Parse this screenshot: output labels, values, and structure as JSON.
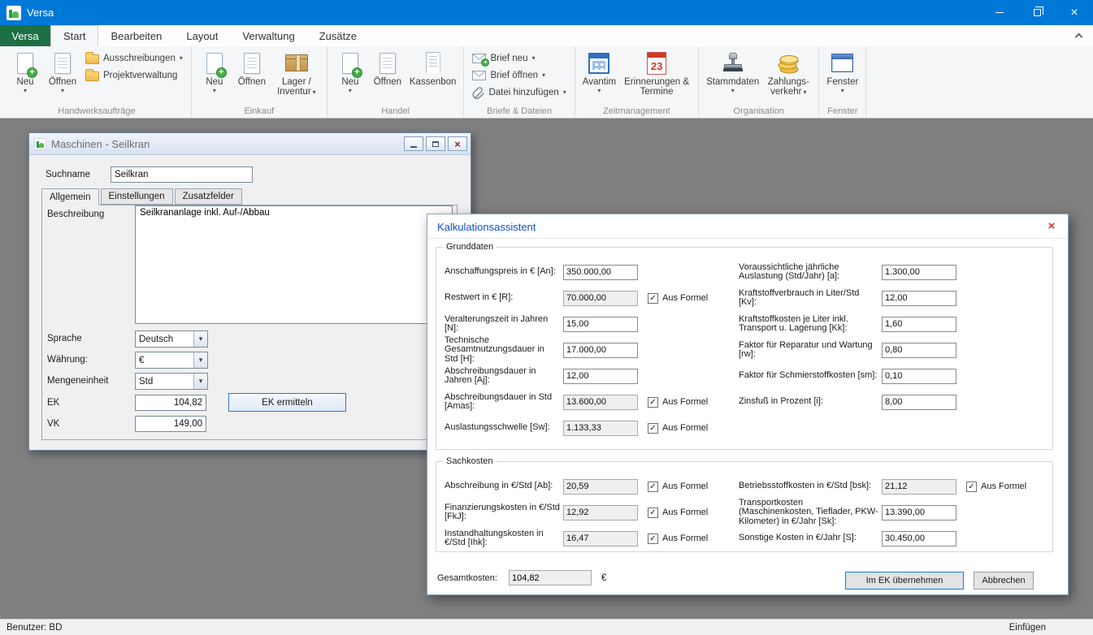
{
  "colors": {
    "titlebar_blue": "#0078d7",
    "versa_green": "#1d7044",
    "workspace_gray": "#7f7f7f",
    "dialog_title_blue": "#0a4fd6",
    "close_red": "#c43b2e",
    "default_button_border": "#2a7ad4"
  },
  "icons": {
    "dropdown_arrow": "▾",
    "close_x": "×",
    "check": "✓",
    "plus": "+"
  },
  "titlebar": {
    "app_title": "Versa"
  },
  "menubar": {
    "file_tab": "Versa",
    "tabs": [
      "Start",
      "Bearbeiten",
      "Layout",
      "Verwaltung",
      "Zusätze"
    ]
  },
  "ribbon": {
    "handwerk": {
      "label": "Handwerksaufträge",
      "neu": "Neu",
      "oeffnen": "Öffnen",
      "ausschreibungen": "Ausschreibungen",
      "projektverwaltung": "Projektverwaltung"
    },
    "einkauf": {
      "label": "Einkauf",
      "neu": "Neu",
      "oeffnen": "Öffnen",
      "lager": "Lager / Inventur"
    },
    "handel": {
      "label": "Handel",
      "neu": "Neu",
      "oeffnen": "Öffnen",
      "kassenbon": "Kassenbon"
    },
    "briefe": {
      "label": "Briefe & Dateien",
      "brief_neu": "Brief neu",
      "brief_oeffnen": "Brief öffnen",
      "datei_hinzufuegen": "Datei hinzufügen"
    },
    "zeit": {
      "label": "Zeitmanagement",
      "avantim": "Avantim",
      "erinnerungen": "Erinnerungen & Termine",
      "kalender_tag": "23"
    },
    "organisation": {
      "label": "Organisation",
      "stammdaten": "Stammdaten",
      "zahlungsverkehr": "Zahlungs-verkehr"
    },
    "fenster": {
      "label": "Fenster",
      "fenster": "Fenster"
    }
  },
  "machine_window": {
    "title": "Maschinen - Seilkran",
    "suchname": {
      "label": "Suchname",
      "value": "Seilkran"
    },
    "tabs": [
      "Allgemein",
      "Einstellungen",
      "Zusatzfelder"
    ],
    "beschreibung": {
      "label": "Beschreibung",
      "value": "Seilkrananlage inkl. Auf-/Abbau"
    },
    "sprache": {
      "label": "Sprache",
      "value": "Deutsch"
    },
    "waehrung": {
      "label": "Währung:",
      "value": "€"
    },
    "mengeneinheit": {
      "label": "Mengeneinheit",
      "value": "Std"
    },
    "ek": {
      "label": "EK",
      "value": "104,82"
    },
    "ek_button": "EK ermitteln",
    "vk": {
      "label": "VK",
      "value": "149,00"
    }
  },
  "dialog": {
    "title": "Kalkulationsassistent",
    "aus_formel": "Aus Formel",
    "grunddaten": {
      "legend": "Grunddaten",
      "left": [
        {
          "label": "Anschaffungspreis in € [An]:",
          "value": "350.000,00",
          "formel": false
        },
        {
          "label": "Restwert in € [R]:",
          "value": "70.000,00",
          "formel": true
        },
        {
          "label": "Veralterungszeit in Jahren [N]:",
          "value": "15,00",
          "formel": false
        },
        {
          "label": "Technische Gesamtnutzungsdauer in Std [H]:",
          "value": "17.000,00",
          "formel": false
        },
        {
          "label": "Abschreibungsdauer in Jahren [Aj]:",
          "value": "12,00",
          "formel": false
        },
        {
          "label": "Abschreibungsdauer in Std [Amas]:",
          "value": "13.600,00",
          "formel": true
        },
        {
          "label": "Auslastungsschwelle [Sw]:",
          "value": "1.133,33",
          "formel": true
        }
      ],
      "right": [
        {
          "label": "Voraussichtliche jährliche Auslastung (Std/Jahr) [a]:",
          "value": "1.300,00",
          "formel": false
        },
        {
          "label": "Kraftstoffverbrauch in Liter/Std [Kv]:",
          "value": "12,00",
          "formel": false
        },
        {
          "label": "Kraftstoffkosten je Liter inkl. Transport u. Lagerung [Kk]:",
          "value": "1,60",
          "formel": false
        },
        {
          "label": "Faktor für Reparatur und Wartung [rw]:",
          "value": "0,80",
          "formel": false
        },
        {
          "label": "Faktor für Schmierstoffkosten [sm]:",
          "value": "0,10",
          "formel": false
        },
        {
          "label": "Zinsfuß in Prozent [i]:",
          "value": "8,00",
          "formel": false
        }
      ]
    },
    "sachkosten": {
      "legend": "Sachkosten",
      "left": [
        {
          "label": "Abschreibung in €/Std [Ab]:",
          "value": "20,59",
          "formel": true
        },
        {
          "label": "Finanzierungskosten in €/Std [FkJ]:",
          "value": "12,92",
          "formel": true
        },
        {
          "label": "Instandhaltungskosten in €/Std [Ihk]:",
          "value": "16,47",
          "formel": true
        }
      ],
      "right": [
        {
          "label": "Betriebsstoffkosten in €/Std [bsk]:",
          "value": "21,12",
          "formel": true
        },
        {
          "label": "Transportkosten (Maschinenkosten, Tieflader, PKW-Kilometer) in €/Jahr [Sk]:",
          "value": "13.390,00",
          "formel": false
        },
        {
          "label": "Sonstige Kosten in €/Jahr [S]:",
          "value": "30.450,00",
          "formel": false
        }
      ]
    },
    "gesamtkosten": {
      "label": "Gesamtkosten:",
      "value": "104,82",
      "currency": "€"
    },
    "buttons": {
      "uebernehmen": "Im EK übernehmen",
      "abbrechen": "Abbrechen"
    }
  },
  "statusbar": {
    "user": "Benutzer: BD",
    "mode": "Einfügen"
  }
}
